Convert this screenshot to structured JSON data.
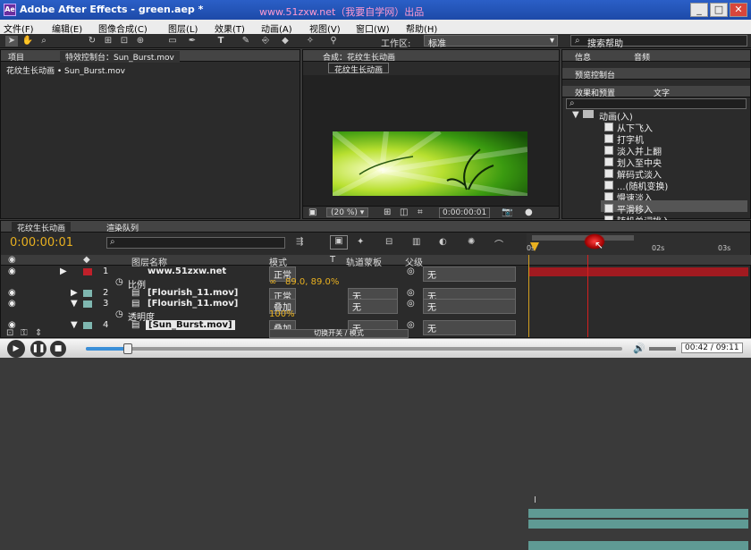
{
  "window": {
    "app_icon": "Ae",
    "title": "Adobe After Effects - green.aep *",
    "watermark": "www.51zxw.net（我要自学网）出品"
  },
  "menu": [
    "文件(F)",
    "编辑(E)",
    "图像合成(C)",
    "图层(L)",
    "效果(T)",
    "动画(A)",
    "视图(V)",
    "窗口(W)",
    "帮助(H)"
  ],
  "toolbar": {
    "workspace_label": "工作区:",
    "workspace_value": "标准",
    "search_help": "搜索帮助"
  },
  "project_panel": {
    "tab_project": "项目",
    "tab_effect_controls": "特效控制台：Sun_Burst.mov",
    "breadcrumb": "花纹生长动画 • Sun_Burst.mov"
  },
  "comp_panel": {
    "tab": "合成：花纹生长动画",
    "comp_button": "花纹生长动画",
    "zoom": "(20 %)",
    "timecode": "0:00:00:01"
  },
  "right_panels": {
    "tab_info": "信息",
    "tab_audio": "音频",
    "tab_preview": "预览控制台",
    "tab_effects": "效果和预置",
    "tab_text": "文字",
    "folder": "动画(入)",
    "presets": [
      "从下飞入",
      "打字机",
      "淡入并上翻",
      "划入至中央",
      "解码式淡入",
      "...(随机变换)",
      "慢速淡入",
      "平滑移入",
      "随机单词挑入"
    ],
    "selected_index": 7
  },
  "timeline": {
    "tab_comp": "花纹生长动画",
    "tab_render": "渲染队列",
    "current_time": "0:00:00:01",
    "columns": {
      "layer_name": "图层名称",
      "mode": "模式",
      "t": "T",
      "track_matte": "轨道蒙板",
      "parent": "父级"
    },
    "rows": [
      {
        "num": "1",
        "name": "www.51zxw.net",
        "mode": "正常",
        "parent": "无",
        "color": "#c0202a"
      },
      {
        "prop": "比例",
        "value": "89.0, 89.0%"
      },
      {
        "num": "2",
        "name": "[Flourish_11.mov]",
        "mode": "正常",
        "matte": "无",
        "parent": "无",
        "color": "#7fb7b0"
      },
      {
        "num": "3",
        "name": "[Flourish_11.mov]",
        "mode": "叠加",
        "matte": "无",
        "parent": "无",
        "color": "#7fb7b0"
      },
      {
        "prop": "透明度",
        "value": "100%"
      },
      {
        "num": "4",
        "name": "[Sun_Burst.mov]",
        "mode": "叠加",
        "matte": "无",
        "parent": "无",
        "color": "#7fb7b0"
      }
    ],
    "ruler": {
      "start": "0s",
      "mid": "02s",
      "end": "03s"
    },
    "switch_toggle": "切换开关 / 模式"
  },
  "player": {
    "time": "00:42 / 09:11"
  }
}
